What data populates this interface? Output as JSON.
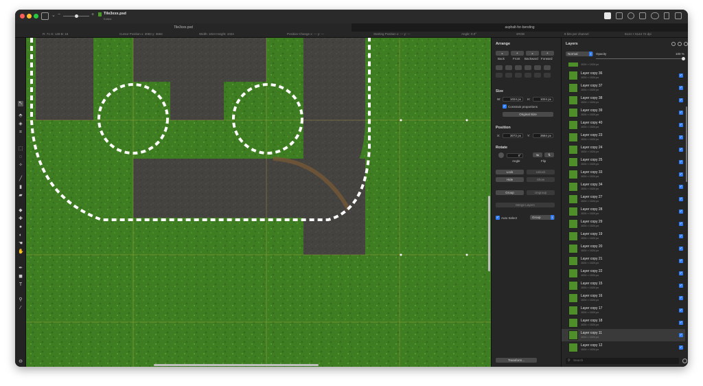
{
  "window": {
    "file_name": "Tile3xxx.psd",
    "file_status": "Edited"
  },
  "tabs": [
    {
      "label": "Tile3xxx.psd"
    },
    {
      "label": "asphalt-for-bending"
    }
  ],
  "info_bar": {
    "rgb": "R: 71   G: 128   B: 16",
    "cursor": "Cursor Position x: 3083   y: 3684",
    "size": "Width: 1024   Height: 1024",
    "position_change": "Position Change x: ---   y: ---",
    "starting_position": "Starting Position x: ---   y: ---",
    "angle": "Angle: 0.0°",
    "profile": "sRGB",
    "depth": "8 bits per channel",
    "dimensions": "6144 × 6144 72 dpi"
  },
  "arrange": {
    "title": "Arrange",
    "order_buttons": [
      "Back",
      "Front",
      "Backward",
      "Forward"
    ],
    "size_title": "Size",
    "w_label": "W:",
    "w_value": "1024 px",
    "h_label": "H:",
    "h_value": "1024 px",
    "constrain_label": "Constrain proportions",
    "original_size_label": "Original Size",
    "position_title": "Position",
    "x_label": "X:",
    "x_value": "3072 px",
    "y_label": "Y:",
    "y_value": "3584 px",
    "rotate_title": "Rotate",
    "angle_value": "0°",
    "angle_label": "Angle",
    "flip_label": "Flip",
    "lock_label": "Lock",
    "unlock_label": "Unlock",
    "hide_label": "Hide",
    "show_label": "Show",
    "group_label": "Group",
    "ungroup_label": "Ungroup",
    "merge_label": "Merge Layers",
    "auto_select_label": "Auto Select",
    "auto_select_value": "Group",
    "transform_label": "Transform..."
  },
  "layers": {
    "title": "Layers",
    "blend_mode": "Normal",
    "opacity_label": "Opacity",
    "opacity_value": "100 %",
    "opacity": 1.0,
    "search_placeholder": "Search",
    "top_partial_size": "1024 × 1024 px",
    "items": [
      {
        "name": "Layer copy 36",
        "size": "1024 × 1024 px",
        "selected": false
      },
      {
        "name": "Layer copy 37",
        "size": "1024 × 1024 px",
        "selected": false
      },
      {
        "name": "Layer copy 38",
        "size": "1024 × 1024 px",
        "selected": false
      },
      {
        "name": "Layer copy 39",
        "size": "1024 × 1024 px",
        "selected": false
      },
      {
        "name": "Layer copy 40",
        "size": "1024 × 1024 px",
        "selected": false
      },
      {
        "name": "Layer copy 23",
        "size": "1024 × 1024 px",
        "selected": false
      },
      {
        "name": "Layer copy 24",
        "size": "1024 × 1024 px",
        "selected": false
      },
      {
        "name": "Layer copy 25",
        "size": "1024 × 1024 px",
        "selected": false
      },
      {
        "name": "Layer copy 33",
        "size": "1024 × 1024 px",
        "selected": false
      },
      {
        "name": "Layer copy 34",
        "size": "1024 × 1024 px",
        "selected": false
      },
      {
        "name": "Layer copy 27",
        "size": "1024 × 1024 px",
        "selected": false
      },
      {
        "name": "Layer copy 28",
        "size": "1024 × 1024 px",
        "selected": false
      },
      {
        "name": "Layer copy 29",
        "size": "1024 × 1024 px",
        "selected": false
      },
      {
        "name": "Layer copy 19",
        "size": "1024 × 1024 px",
        "selected": false
      },
      {
        "name": "Layer copy 20",
        "size": "1024 × 1024 px",
        "selected": false
      },
      {
        "name": "Layer copy 21",
        "size": "1024 × 1024 px",
        "selected": false
      },
      {
        "name": "Layer copy 22",
        "size": "1024 × 1024 px",
        "selected": false
      },
      {
        "name": "Layer copy 15",
        "size": "1024 × 1024 px",
        "selected": false
      },
      {
        "name": "Layer copy 16",
        "size": "1024 × 1024 px",
        "selected": false
      },
      {
        "name": "Layer copy 17",
        "size": "1024 × 1024 px",
        "selected": false
      },
      {
        "name": "Layer copy 18",
        "size": "1024 × 1024 px",
        "selected": false
      },
      {
        "name": "Layer copy 11",
        "size": "1024 × 1024 px",
        "selected": true
      },
      {
        "name": "Layer copy 12",
        "size": "1024 × 1024 px",
        "selected": false
      }
    ]
  },
  "colors": {
    "grass": "#3f7d22",
    "asphalt": "#45433f",
    "accent": "#2f7cf6"
  }
}
